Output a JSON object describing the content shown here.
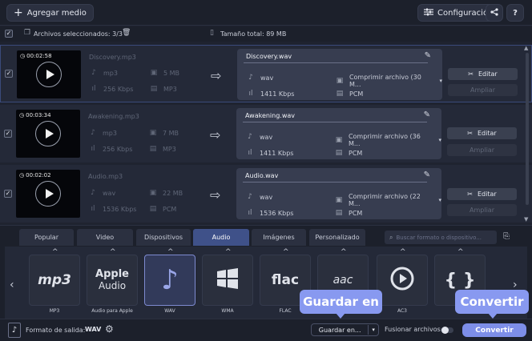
{
  "toolbar": {
    "add_label": "Agregar medio",
    "config_label": "Configuración",
    "help_label": "?"
  },
  "selection": {
    "selected_label": "Archivos seleccionados: 3/3",
    "total_label": "Tamaño total: 89 MB"
  },
  "files": [
    {
      "duration": "00:02:58",
      "source_name": "Discovery.mp3",
      "source_format": "mp3",
      "source_size": "5 MB",
      "source_bitrate": "256 Kbps",
      "source_codec": "MP3",
      "target_name": "Discovery.wav",
      "target_format": "wav",
      "target_compress": "Comprimir archivo (30 M...",
      "target_bitrate": "1411 Kbps",
      "target_codec": "PCM"
    },
    {
      "duration": "00:03:34",
      "source_name": "Awakening.mp3",
      "source_format": "mp3",
      "source_size": "7 MB",
      "source_bitrate": "256 Kbps",
      "source_codec": "MP3",
      "target_name": "Awakening.wav",
      "target_format": "wav",
      "target_compress": "Comprimir archivo (36 M...",
      "target_bitrate": "1411 Kbps",
      "target_codec": "PCM"
    },
    {
      "duration": "00:02:02",
      "source_name": "Audio.mp3",
      "source_format": "wav",
      "source_size": "22 MB",
      "source_bitrate": "1536 Kbps",
      "source_codec": "PCM",
      "target_name": "Audio.wav",
      "target_format": "wav",
      "target_compress": "Comprimir archivo (22 M...",
      "target_bitrate": "1536 Kbps",
      "target_codec": "PCM"
    }
  ],
  "row_buttons": {
    "edit_label": "Editar",
    "extend_label": "Ampliar"
  },
  "tabs": [
    "Popular",
    "Video",
    "Dispositivos",
    "Audio",
    "Imágenes",
    "Personalizado"
  ],
  "active_tab": "Audio",
  "search_placeholder": "Buscar formato o dispositivo...",
  "formats": [
    {
      "label": "MP3",
      "icon": "mp3-logo-icon"
    },
    {
      "label": "Audio para Apple",
      "icon": "apple-audio-icon",
      "text1": "Apple",
      "text2": "Audio"
    },
    {
      "label": "WAV",
      "icon": "music-note-icon"
    },
    {
      "label": "WMA",
      "icon": "windows-logo-icon"
    },
    {
      "label": "FLAC",
      "icon": "flac-logo-icon",
      "text": "flac"
    },
    {
      "label": "",
      "icon": "aac-logo-icon",
      "text": "aac"
    },
    {
      "label": "AC3",
      "icon": "ac3-play-icon"
    },
    {
      "label": "",
      "icon": "braces-icon",
      "text": "{ }"
    }
  ],
  "bottom": {
    "output_label": "Formato de salida:",
    "output_value": "WAV",
    "save_label": "Guardar en...",
    "merge_label": "Fusionar archivos:",
    "convert_label": "Convertir"
  },
  "tooltips": {
    "save_tip": "Guardar en",
    "convert_tip": "Convertir"
  },
  "colors": {
    "accent": "#7d8ee8",
    "tooltip": "#8899f0",
    "active_tab": "#3f5189",
    "background": "#1f2330"
  }
}
